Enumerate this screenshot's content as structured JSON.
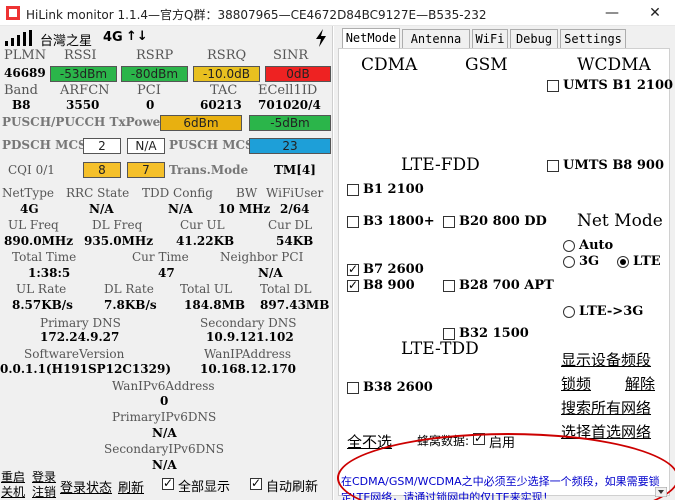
{
  "window": {
    "title": "HiLink monitor 1.1.4—官方Q群：38807965—CE4672D84BC9127E—B535-232",
    "minimize": "—",
    "close": "✕"
  },
  "status": {
    "operator": "台灣之星",
    "network": "4G",
    "arrows": "↑↓"
  },
  "signal": {
    "headers": [
      "PLMN",
      "RSSI",
      "RSRP",
      "RSRQ",
      "SINR"
    ],
    "plmn": "46689",
    "rssi": "-53dBm",
    "rsrp": "-80dBm",
    "rsrq": "-10.0dB",
    "sinr": "0dB"
  },
  "cell": {
    "headers": [
      "Band",
      "ARFCN",
      "PCI",
      "TAC",
      "ECell1ID"
    ],
    "band": "B8",
    "arfcn": "3550",
    "pci": "0",
    "tac": "60213",
    "ecellid": "701020/4"
  },
  "txpower": {
    "label": "PUSCH/PUCCH TxPower",
    "pusch": "6dBm",
    "pucch": "-5dBm"
  },
  "mcs": {
    "pdsch_label": "PDSCH MCS",
    "pdsch_1": "2",
    "pdsch_2": "N/A",
    "pusch_label": "PUSCH MCS",
    "pusch": "23",
    "cqi_label": "CQI 0/1",
    "cqi_0": "8",
    "cqi_1": "7",
    "trans_label": "Trans.Mode",
    "trans_value": "TM[4]"
  },
  "net": {
    "headers": [
      "NetType",
      "RRC State",
      "TDD Config",
      "BW",
      "WiFiUser"
    ],
    "nettype": "4G",
    "rrc": "N/A",
    "tdd": "N/A",
    "bw": "10 MHz",
    "wifiuser": "2/64"
  },
  "freq": {
    "headers": [
      "UL Freq",
      "DL Freq",
      "Cur UL",
      "Cur DL"
    ],
    "ul": "890.0MHz",
    "dl": "935.0MHz",
    "cur_ul": "41.22KB",
    "cur_dl": "54KB"
  },
  "time": {
    "total_label": "Total Time",
    "cur_label": "Cur Time",
    "neighbor_label": "Neighbor PCI",
    "total": "1:38:5",
    "cur": "47",
    "neighbor": "N/A"
  },
  "rate": {
    "headers": [
      "UL Rate",
      "DL Rate",
      "Total UL",
      "Total DL"
    ],
    "ul": "8.57KB/s",
    "dl": "7.8KB/s",
    "total_ul": "184.8MB",
    "total_dl": "897.43MB"
  },
  "dns": {
    "primary_label": "Primary DNS",
    "secondary_label": "Secondary DNS",
    "primary": "172.24.9.27",
    "secondary": "10.9.121.102"
  },
  "device": {
    "sw_label": "SoftwareVersion",
    "wanip_label": "WanIPAddress",
    "sw": "0.0.1.1(H191SP12C1329)",
    "wanip": "10.168.12.170",
    "wanipv6_label": "WanIPv6Address",
    "wanipv6": "0",
    "pdns6_label": "PrimaryIPv6DNS",
    "pdns6": "N/A",
    "sdns6_label": "SecondaryIPv6DNS",
    "sdns6": "N/A"
  },
  "bottom": {
    "restart": "重启",
    "shutdown": "关机",
    "login": "登录",
    "logout": "注销",
    "login_status": "登录状态",
    "refresh": "刷新",
    "show_all": "全部显示",
    "auto_refresh": "自动刷新"
  },
  "tabs": [
    "NetMode",
    "Antenna",
    "WiFi",
    "Debug",
    "Settings"
  ],
  "netmode": {
    "cdma": "CDMA",
    "gsm": "GSM",
    "wcdma": "WCDMA",
    "lte_fdd": "LTE-FDD",
    "lte_tdd": "LTE-TDD",
    "umts_b1": "UMTS B1  2100",
    "umts_b8": "UMTS B8  900",
    "b1": "B1  2100",
    "b3": "B3  1800+",
    "b20": "B20 800 DD",
    "b7": "B7  2600",
    "b8": "B8  900",
    "b28": "B28 700 APT",
    "b32": "B32 1500",
    "b38": "B38 2600",
    "net_mode_title": "Net Mode",
    "auto": "Auto",
    "three_g": "3G",
    "lte": "LTE",
    "lte_3g": "LTE->3G",
    "show_bands": "显示设备频段",
    "lock_band": "锁频",
    "unlock": "解除",
    "search_all": "搜索所有网络",
    "select_first": "选择首选网络",
    "none_selected": "全不选",
    "cellular_data": "蜂窝数据:",
    "enable": "启用",
    "notice": "在CDMA/GSM/WCDMA之中必须至少选择一个频段，如果需要锁定LTE网络，请通过锁网中的仅LTE来实现！"
  },
  "colors": {
    "rssi_bg": "#2bb54a",
    "rsrp_bg": "#2bb54a",
    "rsrq_bg": "#e8c020",
    "sinr_bg": "#ee2222",
    "pusch_tx_bg": "#e8b010",
    "pucch_tx_bg": "#2bb54a",
    "pusch_mcs_bg": "#1e9fd8",
    "cqi_bg": "#f5c02a",
    "notice_text": "#0000cc",
    "ellipse": "#cc0000"
  }
}
